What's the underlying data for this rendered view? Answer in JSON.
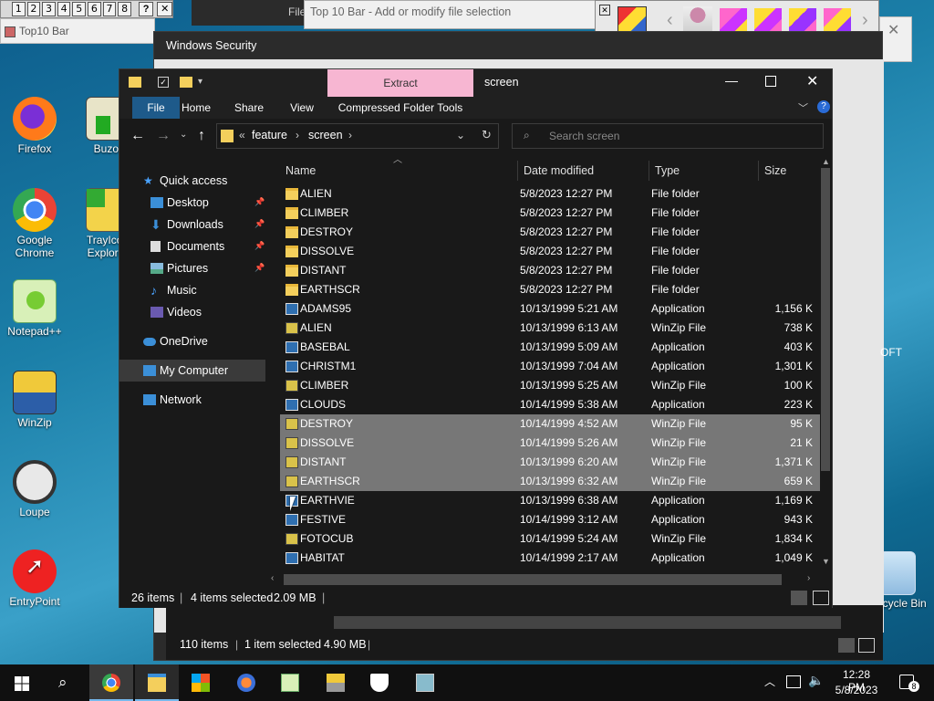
{
  "toolbar10": {
    "buttons": [
      "1",
      "2",
      "3",
      "4",
      "5",
      "6",
      "7",
      "8"
    ],
    "help": "?",
    "close": "✕",
    "title": "Top10 Bar"
  },
  "top10_window": {
    "title": "Top 10 Bar - Add or modify file selection"
  },
  "bg_window": {
    "title_fragment": "File"
  },
  "security": {
    "title": "Windows Security"
  },
  "desktop_icons": [
    {
      "name": "firefox",
      "label": "Firefox"
    },
    {
      "name": "buzof",
      "label": "Buzof"
    },
    {
      "name": "chrome",
      "label": "Google Chrome"
    },
    {
      "name": "trayicon",
      "label": "TrayIcon Explorer"
    },
    {
      "name": "notepadpp",
      "label": "Notepad++"
    },
    {
      "name": "winzip",
      "label": "WinZip"
    },
    {
      "name": "loupe",
      "label": "Loupe"
    },
    {
      "name": "entrypoint",
      "label": "EntryPoint"
    },
    {
      "name": "recycle",
      "label": "Recycle Bin"
    }
  ],
  "explorer": {
    "title": "screen",
    "context_tab": "Extract",
    "tabs": [
      "File",
      "Home",
      "Share",
      "View",
      "Compressed Folder Tools"
    ],
    "breadcrumb": [
      "«",
      "feature",
      "screen"
    ],
    "search_placeholder": "Search screen",
    "nav": {
      "quick_access": "Quick access",
      "items": [
        "Desktop",
        "Downloads",
        "Documents",
        "Pictures",
        "Music",
        "Videos"
      ],
      "onedrive": "OneDrive",
      "mycomputer": "My Computer",
      "network": "Network"
    },
    "columns": {
      "name": "Name",
      "date": "Date modified",
      "type": "Type",
      "size": "Size"
    },
    "files": [
      {
        "name": "ALIEN",
        "date": "5/8/2023 12:27 PM",
        "type": "File folder",
        "size": "",
        "icon": "folder",
        "selected": false
      },
      {
        "name": "CLIMBER",
        "date": "5/8/2023 12:27 PM",
        "type": "File folder",
        "size": "",
        "icon": "folder",
        "selected": false
      },
      {
        "name": "DESTROY",
        "date": "5/8/2023 12:27 PM",
        "type": "File folder",
        "size": "",
        "icon": "folder",
        "selected": false
      },
      {
        "name": "DISSOLVE",
        "date": "5/8/2023 12:27 PM",
        "type": "File folder",
        "size": "",
        "icon": "folder",
        "selected": false
      },
      {
        "name": "DISTANT",
        "date": "5/8/2023 12:27 PM",
        "type": "File folder",
        "size": "",
        "icon": "folder",
        "selected": false
      },
      {
        "name": "EARTHSCR",
        "date": "5/8/2023 12:27 PM",
        "type": "File folder",
        "size": "",
        "icon": "folder",
        "selected": false
      },
      {
        "name": "ADAMS95",
        "date": "10/13/1999 5:21 AM",
        "type": "Application",
        "size": "1,156 K",
        "icon": "app",
        "selected": false
      },
      {
        "name": "ALIEN",
        "date": "10/13/1999 6:13 AM",
        "type": "WinZip File",
        "size": "738 K",
        "icon": "zip",
        "selected": false
      },
      {
        "name": "BASEBAL",
        "date": "10/13/1999 5:09 AM",
        "type": "Application",
        "size": "403 K",
        "icon": "app",
        "selected": false
      },
      {
        "name": "CHRISTM1",
        "date": "10/13/1999 7:04 AM",
        "type": "Application",
        "size": "1,301 K",
        "icon": "app",
        "selected": false
      },
      {
        "name": "CLIMBER",
        "date": "10/13/1999 5:25 AM",
        "type": "WinZip File",
        "size": "100 K",
        "icon": "zip",
        "selected": false
      },
      {
        "name": "CLOUDS",
        "date": "10/14/1999 5:38 AM",
        "type": "Application",
        "size": "223 K",
        "icon": "app",
        "selected": false
      },
      {
        "name": "DESTROY",
        "date": "10/14/1999 4:52 AM",
        "type": "WinZip File",
        "size": "95 K",
        "icon": "zip",
        "selected": true
      },
      {
        "name": "DISSOLVE",
        "date": "10/14/1999 5:26 AM",
        "type": "WinZip File",
        "size": "21 K",
        "icon": "zip",
        "selected": true
      },
      {
        "name": "DISTANT",
        "date": "10/13/1999 6:20 AM",
        "type": "WinZip File",
        "size": "1,371 K",
        "icon": "zip",
        "selected": true
      },
      {
        "name": "EARTHSCR",
        "date": "10/13/1999 6:32 AM",
        "type": "WinZip File",
        "size": "659 K",
        "icon": "zip",
        "selected": true
      },
      {
        "name": "EARTHVIE",
        "date": "10/13/1999 6:38 AM",
        "type": "Application",
        "size": "1,169 K",
        "icon": "app",
        "selected": false
      },
      {
        "name": "FESTIVE",
        "date": "10/14/1999 3:12 AM",
        "type": "Application",
        "size": "943 K",
        "icon": "app",
        "selected": false
      },
      {
        "name": "FOTOCUB",
        "date": "10/14/1999 5:24 AM",
        "type": "WinZip File",
        "size": "1,834 K",
        "icon": "zip",
        "selected": false
      },
      {
        "name": "HABITAT",
        "date": "10/14/1999 2:17 AM",
        "type": "Application",
        "size": "1,049 K",
        "icon": "app",
        "selected": false
      }
    ],
    "status": {
      "count": "26 items",
      "selected": "4 items selected",
      "size": "2.09 MB"
    }
  },
  "back_explorer": {
    "status_count": "110 items",
    "status_selected": "1 item selected",
    "status_size": "4.90 MB",
    "side_text": "OFT"
  },
  "taskbar": {
    "apps": [
      "chrome",
      "file-explorer",
      "store",
      "firefox-like",
      "notepadpp",
      "winzip",
      "security",
      "toolbar"
    ],
    "time": "12:28 PM",
    "date": "5/8/2023",
    "notifications": "8"
  },
  "colors": {
    "selection": "#777777",
    "accent": "#76b9ed",
    "ribbon_file": "#1e5a8a",
    "extract": "#f7b6d2"
  }
}
